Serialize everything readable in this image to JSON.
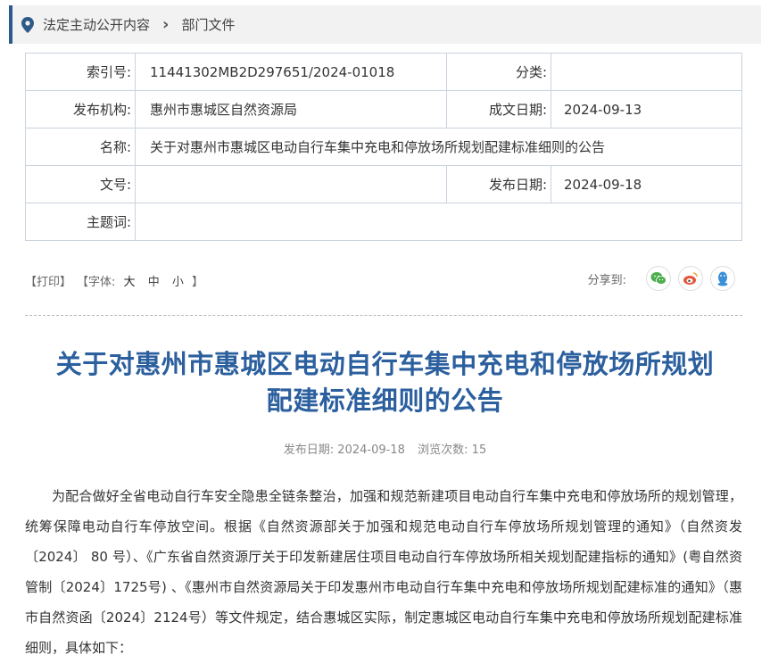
{
  "breadcrumb": {
    "item1": "法定主动公开内容",
    "separator": "›",
    "item2": "部门文件"
  },
  "meta": {
    "index_label": "索引号:",
    "index_value": "11441302MB2D297651/2024-01018",
    "category_label": "分类:",
    "category_value": "",
    "publisher_label": "发布机构:",
    "publisher_value": "惠州市惠城区自然资源局",
    "written_date_label": "成文日期:",
    "written_date_value": "2024-09-13",
    "name_label": "名称:",
    "name_value": "关于对惠州市惠城区电动自行车集中充电和停放场所规划配建标准细则的公告",
    "doc_no_label": "文号:",
    "doc_no_value": "",
    "publish_date_label": "发布日期:",
    "publish_date_value": "2024-09-18",
    "subject_label": "主题词:",
    "subject_value": ""
  },
  "toolbar": {
    "print": "【打印】",
    "font_open": "【字体:",
    "font_large": "大",
    "font_medium": "中",
    "font_small": "小",
    "font_close": "】",
    "share_label": "分享到:"
  },
  "article": {
    "title_line1": "关于对惠州市惠城区电动自行车集中充电和停放场所规划",
    "title_line2": "配建标准细则的公告",
    "publish_label": "发布日期:",
    "publish_date": "2024-09-18",
    "views_label": "浏览次数:",
    "views": "15",
    "paragraph": "为配合做好全省电动自行车安全隐患全链条整治，加强和规范新建项目电动自行车集中充电和停放场所的规划管理，统筹保障电动自行车停放空间。根据《自然资源部关于加强和规范电动自行车停放场所规划管理的通知》（自然资发〔2024〕 80 号）、《广东省自然资源厅关于印发新建居住项目电动自行车停放场所相关规划配建指标的通知》(粤自然资管制〔2024〕1725号) 、《惠州市自然资源局关于印发惠州市电动自行车集中充电和停放场所规划配建标准的通知》（惠市自然资函〔2024〕2124号）等文件规定，结合惠城区实际，制定惠城区电动自行车集中充电和停放场所规划配建标准细则，具体如下："
  },
  "colors": {
    "accent": "#2b5f9e",
    "breadcrumb_bar": "#2d5a88",
    "wechat": "#4cae4c",
    "weibo": "#e6553a",
    "qq": "#3a8fd6"
  },
  "icons": [
    "location-pin-icon",
    "wechat-icon",
    "weibo-icon",
    "qq-icon"
  ]
}
